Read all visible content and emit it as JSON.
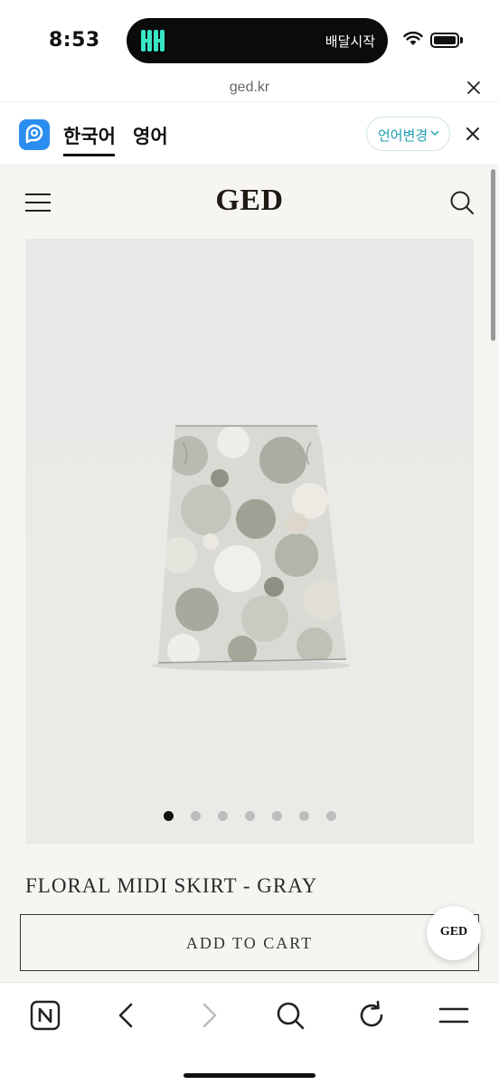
{
  "status_bar": {
    "time": "8:53",
    "island_label": "배달시작"
  },
  "url_bar": {
    "domain": "ged.kr"
  },
  "translate_bar": {
    "lang_source": "한국어",
    "lang_target": "영어",
    "change_label": "언어변경"
  },
  "site": {
    "brand": "GED"
  },
  "product": {
    "name": "FLORAL MIDI SKIRT - GRAY",
    "add_to_cart_label": "ADD TO CART",
    "image_count": 7,
    "active_image_index": 0
  },
  "floating_badge": {
    "label": "GED"
  },
  "colors": {
    "page_background": "#f6f5f2",
    "brand_text": "#1e1a12",
    "translate_accent": "#1e9eb0",
    "papago_blue": "#2b8df0",
    "island_app_accent": "#38e6c4"
  }
}
